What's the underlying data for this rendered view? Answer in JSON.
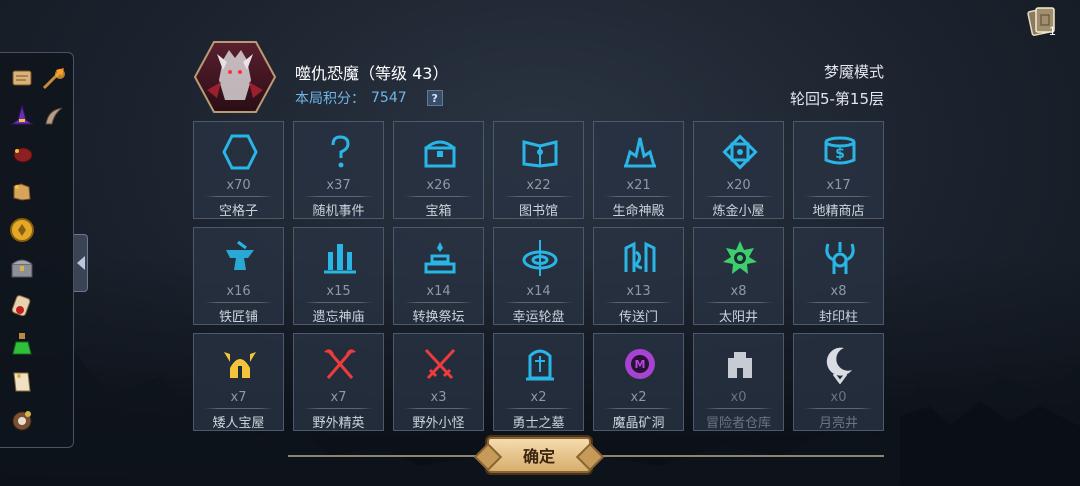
{
  "header": {
    "boss_name": "噬仇恐魔（等级 43）",
    "score_label": "本局积分：",
    "score_value": "7547",
    "help_label": "?",
    "mode": "梦魇模式",
    "round": "轮回5-第15层"
  },
  "cards": {
    "count": "1",
    "icon": "cards-icon"
  },
  "sidebar": {
    "items": [
      {
        "icon": "scroll-icon"
      },
      {
        "icon": "fire-arrow-icon"
      },
      {
        "icon": "witch-hat-icon"
      },
      {
        "icon": "horn-icon"
      },
      {
        "icon": "meat-icon"
      },
      {
        "icon": "map-icon"
      },
      {
        "icon": "gold-coin-icon"
      },
      {
        "icon": "chest-icon"
      },
      {
        "icon": "sealed-scroll-icon"
      },
      {
        "icon": "potion-icon"
      },
      {
        "icon": "paper-icon"
      },
      {
        "icon": "pot-icon"
      }
    ]
  },
  "grid": [
    {
      "count": "x70",
      "name": "空格子",
      "icon": "hexagon-icon",
      "color": "#29b6e6"
    },
    {
      "count": "x37",
      "name": "随机事件",
      "icon": "question-icon",
      "color": "#29b6e6"
    },
    {
      "count": "x26",
      "name": "宝箱",
      "icon": "chest-icon",
      "color": "#29b6e6"
    },
    {
      "count": "x22",
      "name": "图书馆",
      "icon": "book-icon",
      "color": "#29b6e6"
    },
    {
      "count": "x21",
      "name": "生命神殿",
      "icon": "temple-icon",
      "color": "#29b6e6"
    },
    {
      "count": "x20",
      "name": "炼金小屋",
      "icon": "alchemy-icon",
      "color": "#29b6e6"
    },
    {
      "count": "x17",
      "name": "地精商店",
      "icon": "shop-icon",
      "color": "#29b6e6"
    },
    {
      "count": "x16",
      "name": "铁匠铺",
      "icon": "anvil-icon",
      "color": "#29b6e6"
    },
    {
      "count": "x15",
      "name": "遗忘神庙",
      "icon": "shrine-icon",
      "color": "#29b6e6"
    },
    {
      "count": "x14",
      "name": "转换祭坛",
      "icon": "altar-icon",
      "color": "#29b6e6"
    },
    {
      "count": "x14",
      "name": "幸运轮盘",
      "icon": "wheel-icon",
      "color": "#29b6e6"
    },
    {
      "count": "x13",
      "name": "传送门",
      "icon": "portal-icon",
      "color": "#29b6e6"
    },
    {
      "count": "x8",
      "name": "太阳井",
      "icon": "sun-icon",
      "color": "#3ccf6b"
    },
    {
      "count": "x8",
      "name": "封印柱",
      "icon": "seal-icon",
      "color": "#29b6e6"
    },
    {
      "count": "x7",
      "name": "矮人宝屋",
      "icon": "dwarf-helmet-icon",
      "color": "#f2c53a"
    },
    {
      "count": "x7",
      "name": "野外精英",
      "icon": "crossed-axes-icon",
      "color": "#ef3b3b"
    },
    {
      "count": "x3",
      "name": "野外小怪",
      "icon": "crossed-swords-icon",
      "color": "#ef3b3b"
    },
    {
      "count": "x2",
      "name": "勇士之墓",
      "icon": "tomb-icon",
      "color": "#29b6e6"
    },
    {
      "count": "x2",
      "name": "魔晶矿洞",
      "icon": "crystal-mine-icon",
      "color": "#b447e0"
    },
    {
      "count": "x0",
      "name": "冒险者仓库",
      "icon": "warehouse-icon",
      "color": "#d9dde3"
    },
    {
      "count": "x0",
      "name": "月亮井",
      "icon": "moon-icon",
      "color": "#d9dde3"
    }
  ],
  "confirm": {
    "label": "确定"
  }
}
